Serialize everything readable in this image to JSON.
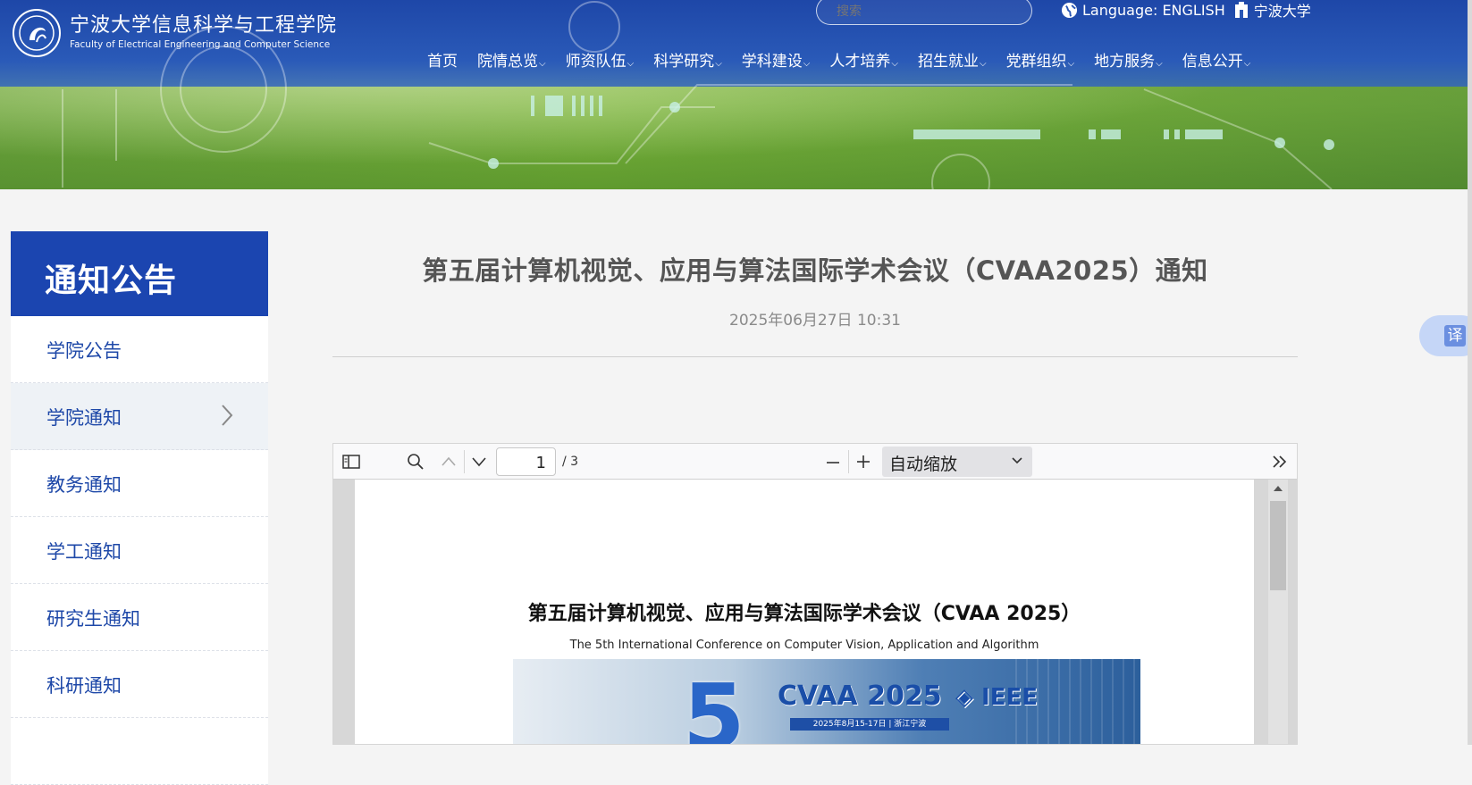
{
  "header": {
    "logo_cn": "宁波大学信息科学与工程学院",
    "logo_en": "Faculty of Electrical Engineering and Computer Science",
    "search_placeholder": "搜索",
    "language_label": "Language: ENGLISH",
    "university_link": "宁波大学",
    "nav": [
      "首页",
      "院情总览",
      "师资队伍",
      "科学研究",
      "学科建设",
      "人才培养",
      "招生就业",
      "党群组织",
      "地方服务",
      "信息公开"
    ]
  },
  "sidebar": {
    "title": "通知公告",
    "items": [
      {
        "label": "学院公告"
      },
      {
        "label": "学院通知"
      },
      {
        "label": "教务通知"
      },
      {
        "label": "学工通知"
      },
      {
        "label": "研究生通知"
      },
      {
        "label": "科研通知"
      }
    ]
  },
  "article": {
    "title": "第五届计算机视觉、应用与算法国际学术会议（CVAA2025）通知",
    "date": "2025年06月27日 10:31"
  },
  "pdf_viewer": {
    "page_number": "1",
    "page_count": "/ 3",
    "zoom_label": "自动缩放",
    "doc_title": "第五届计算机视觉、应用与算法国际学术会议（CVAA 2025）",
    "doc_subtitle": "The 5th International Conference on Computer Vision, Application and Algorithm",
    "banner_number": "5",
    "banner_title": "CVAA 2025",
    "banner_ieee": "IEEE",
    "banner_date": "2025年8月15-17日 | 浙江宁波"
  },
  "translate_button": "译",
  "colors": {
    "brand_blue": "#1b45b0",
    "link_blue": "#1e48a8"
  }
}
